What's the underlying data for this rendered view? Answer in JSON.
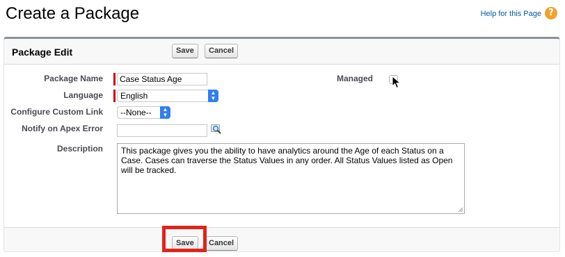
{
  "page": {
    "title": "Create a Package",
    "help_link": "Help for this Page",
    "help_icon": "help-icon"
  },
  "panel": {
    "title": "Package Edit",
    "save_label": "Save",
    "cancel_label": "Cancel"
  },
  "form": {
    "package_name_label": "Package Name",
    "package_name_value": "Case Status Age",
    "language_label": "Language",
    "language_value": "English",
    "custom_link_label": "Configure Custom Link",
    "custom_link_value": "--None--",
    "notify_label": "Notify on Apex Error",
    "notify_value": "",
    "description_label": "Description",
    "description_value": "This package gives you the ability to have analytics around the Age of each Status on a Case. Cases can traverse the Status Values in any order. All Status Values listed as Open will be tracked.",
    "managed_label": "Managed",
    "managed_checked": false
  },
  "footer": {
    "save_label": "Save",
    "cancel_label": "Cancel"
  },
  "colors": {
    "required_marker": "#cc0000",
    "highlight": "#e2231a",
    "select_arrow": "#2f7ff0"
  }
}
